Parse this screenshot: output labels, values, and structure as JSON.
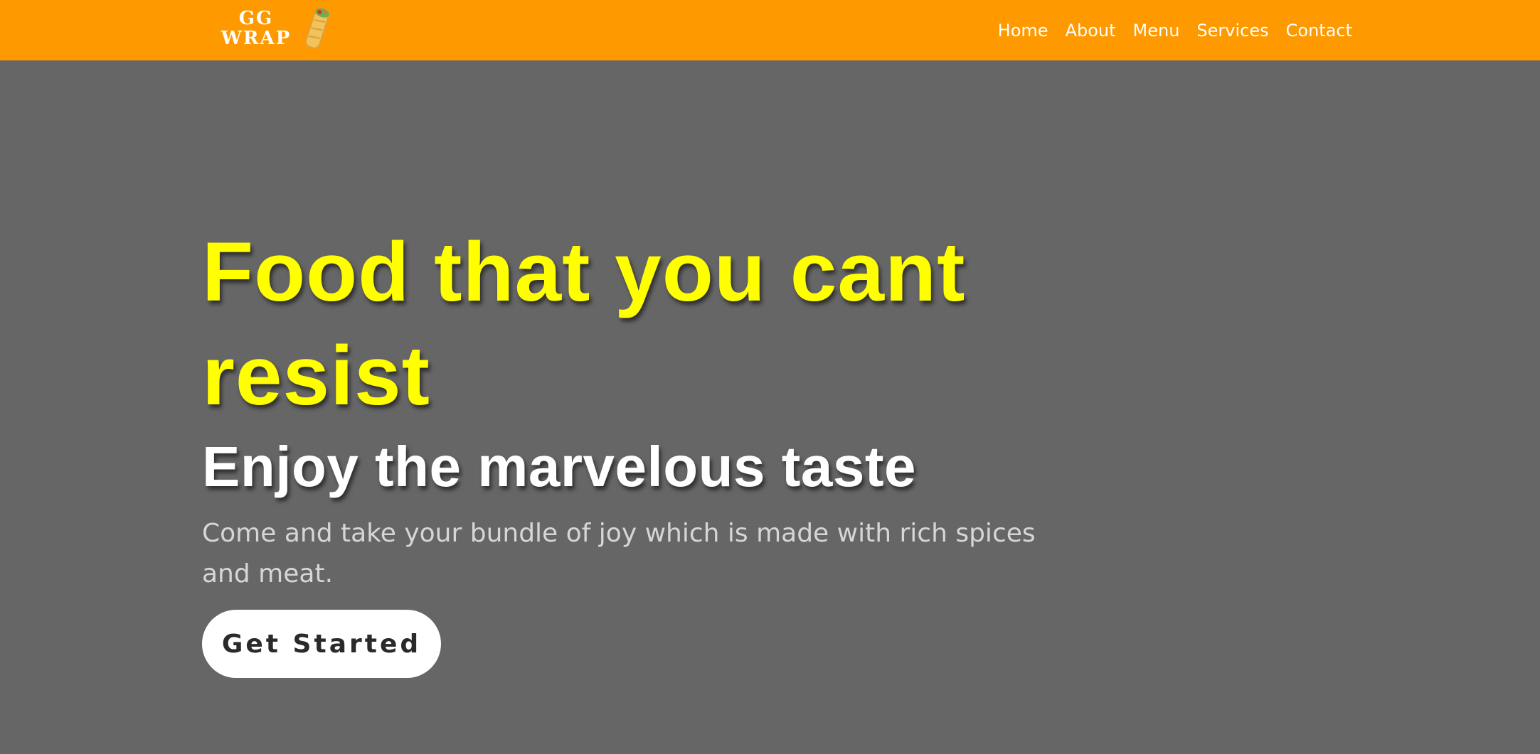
{
  "brand": {
    "line1": "GG",
    "line2": "WRAP",
    "icon": "wrap-food-icon"
  },
  "nav": {
    "items": [
      {
        "label": "Home"
      },
      {
        "label": "About"
      },
      {
        "label": "Menu"
      },
      {
        "label": "Services"
      },
      {
        "label": "Contact"
      }
    ]
  },
  "hero": {
    "title": "Food that you cant resist",
    "subtitle": "Enjoy the marvelous taste",
    "text": "Come and take your bundle of joy which is made with rich spices and meat.",
    "cta_label": "Get Started"
  },
  "colors": {
    "navbar": "#ff9900",
    "background": "#666666",
    "title": "#ffff00",
    "subtitle": "#ffffff",
    "text": "#d6d6d6"
  }
}
